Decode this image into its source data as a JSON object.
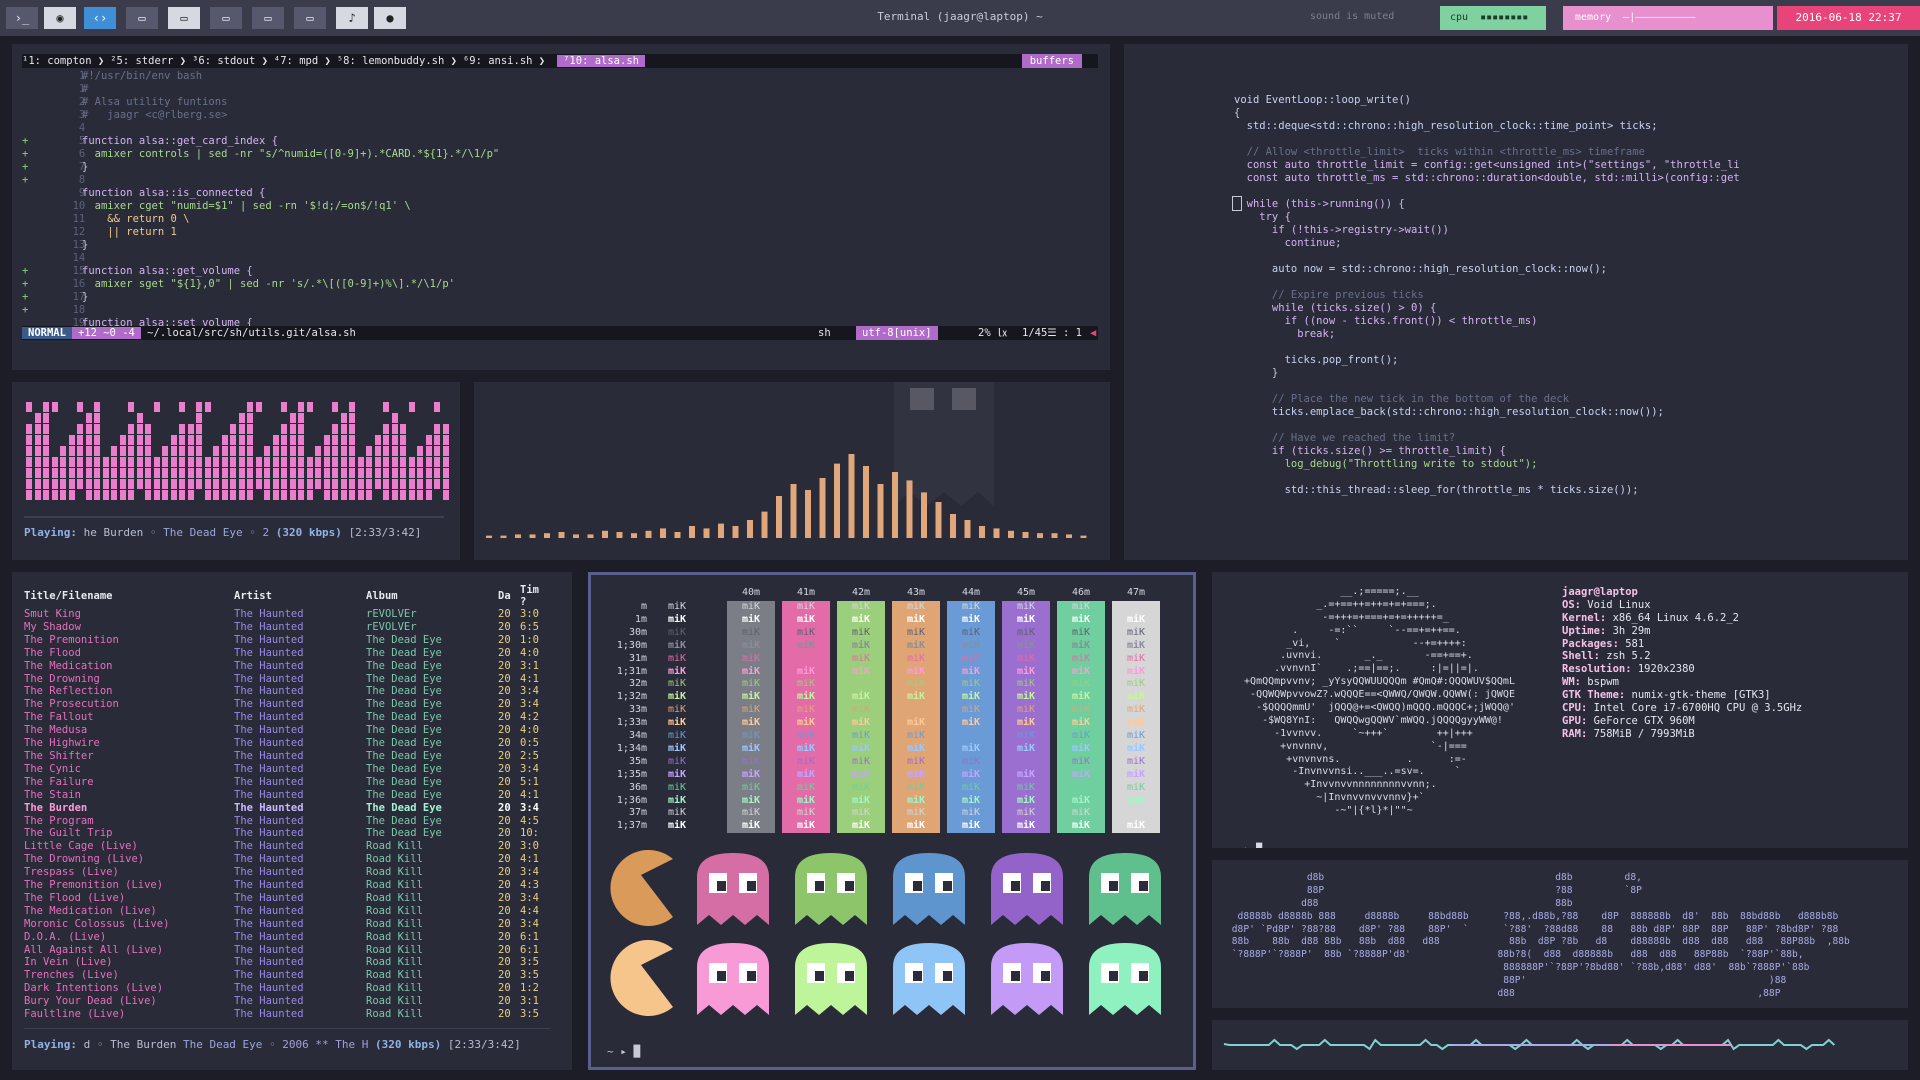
{
  "topbar": {
    "buttons": [
      "›_",
      "◉",
      "‹›",
      "▭",
      "▭",
      "▭",
      "▭",
      "▭",
      "♪",
      "●"
    ],
    "title": "Terminal (jaagr@laptop) ~",
    "sound_status": "sound is muted",
    "cpu_label": "cpu",
    "cpu_meter": "▪▪▪▪▪▪▪▪",
    "memory_label": "memory",
    "memory_meter": "—|——————————",
    "datetime": "2016-06-18 22:37",
    "colors": {
      "cpu": "#7fd2a0",
      "memory": "#e88fce",
      "date": "#e9447a"
    }
  },
  "vim": {
    "tabs": [
      "¹1: compton",
      "²5: stderr",
      "³6: stdout",
      "⁴7: mpd",
      "⁵8: lemonbuddy.sh",
      "⁶9: ansi.sh"
    ],
    "active_tab": "⁷10: alsa.sh",
    "buffers_label": "buffers",
    "lines": [
      {
        "gutter": "  1 ",
        "sign": " ",
        "text": "#!/usr/bin/env bash",
        "cls": "cm"
      },
      {
        "gutter": "  1 ",
        "sign": " ",
        "text": "#",
        "cls": "cm"
      },
      {
        "gutter": "  2 ",
        "sign": " ",
        "text": "# Alsa utility funtions",
        "cls": "cm"
      },
      {
        "gutter": "  3 ",
        "sign": " ",
        "text": "#   jaagr <c@rlberg.se>",
        "cls": "cm"
      },
      {
        "gutter": "  4 ",
        "sign": " ",
        "text": "",
        "cls": ""
      },
      {
        "gutter": "  5 ",
        "sign": "+",
        "text": "function alsa::get_card_index {",
        "cls": "kw"
      },
      {
        "gutter": "  6 ",
        "sign": "+",
        "text": "  amixer controls | sed -nr \"s/^numid=([0-9]+).*CARD.*${1}.*/\\1/p\"",
        "cls": "str"
      },
      {
        "gutter": "  7 ",
        "sign": "+",
        "text": "}",
        "cls": ""
      },
      {
        "gutter": "  8 ",
        "sign": "+",
        "text": "",
        "cls": ""
      },
      {
        "gutter": "  9 ",
        "sign": " ",
        "text": "function alsa::is_connected {",
        "cls": "kw"
      },
      {
        "gutter": " 10 ",
        "sign": " ",
        "text": "  amixer cget \"numid=$1\" | sed -rn '$!d;/=on$/!q1' \\",
        "cls": "str"
      },
      {
        "gutter": " 11 ",
        "sign": " ",
        "text": "    && return 0 \\",
        "cls": "var"
      },
      {
        "gutter": " 12 ",
        "sign": " ",
        "text": "    || return 1",
        "cls": "var"
      },
      {
        "gutter": " 13 ",
        "sign": " ",
        "text": "}",
        "cls": ""
      },
      {
        "gutter": " 14 ",
        "sign": " ",
        "text": "",
        "cls": ""
      },
      {
        "gutter": " 15 ",
        "sign": "+",
        "text": "function alsa::get_volume {",
        "cls": "kw"
      },
      {
        "gutter": " 16 ",
        "sign": "+",
        "text": "  amixer sget \"${1},0\" | sed -nr 's/.*\\[([0-9]+)%\\].*/\\1/p'",
        "cls": "str"
      },
      {
        "gutter": " 17 ",
        "sign": "+",
        "text": "}",
        "cls": ""
      },
      {
        "gutter": " 18 ",
        "sign": "+",
        "text": "",
        "cls": ""
      },
      {
        "gutter": " 19 ",
        "sign": " ",
        "text": "function alsa::set_volume {",
        "cls": "kw"
      }
    ],
    "status": {
      "mode": "NORMAL",
      "hunks": "+12 ~0 -4",
      "path": "~/.local/src/sh/utils.git/alsa.sh",
      "filetype": "sh",
      "encoding": "utf-8[unix]",
      "percent": "2% ㏓",
      "position": "1/45☰ :  1"
    }
  },
  "cpp": {
    "lines": [
      {
        "text": "void EventLoop::loop_write()",
        "cls": "fn"
      },
      {
        "text": "{",
        "cls": ""
      },
      {
        "text": "  std::deque<std::chrono::high_resolution_clock::time_point> ticks;",
        "cls": "fn"
      },
      {
        "text": "",
        "cls": ""
      },
      {
        "text": "  // Allow <throttle_limit>  ticks within <throttle_ms> timeframe",
        "cls": "cm"
      },
      {
        "text": "  const auto throttle_limit = config::get<unsigned int>(\"settings\", \"throttle_li",
        "cls": "kw"
      },
      {
        "text": "  const auto throttle_ms = std::chrono::duration<double, std::milli>(config::get",
        "cls": "kw"
      },
      {
        "text": "",
        "cls": ""
      },
      {
        "text": "  while (this->running()) {",
        "cls": "kw"
      },
      {
        "text": "    try {",
        "cls": "kw"
      },
      {
        "text": "      if (!this->registry->wait())",
        "cls": "kw"
      },
      {
        "text": "        continue;",
        "cls": "kw"
      },
      {
        "text": "",
        "cls": ""
      },
      {
        "text": "      auto now = std::chrono::high_resolution_clock::now();",
        "cls": "fn"
      },
      {
        "text": "",
        "cls": ""
      },
      {
        "text": "      // Expire previous ticks",
        "cls": "cm"
      },
      {
        "text": "      while (ticks.size() > 0) {",
        "cls": "kw"
      },
      {
        "text": "        if ((now - ticks.front()) < throttle_ms)",
        "cls": "kw"
      },
      {
        "text": "          break;",
        "cls": "kw"
      },
      {
        "text": "",
        "cls": ""
      },
      {
        "text": "        ticks.pop_front();",
        "cls": "fn"
      },
      {
        "text": "      }",
        "cls": ""
      },
      {
        "text": "",
        "cls": ""
      },
      {
        "text": "      // Place the new tick in the bottom of the deck",
        "cls": "cm"
      },
      {
        "text": "      ticks.emplace_back(std::chrono::high_resolution_clock::now());",
        "cls": "fn"
      },
      {
        "text": "",
        "cls": ""
      },
      {
        "text": "      // Have we reached the limit?",
        "cls": "cm"
      },
      {
        "text": "      if (ticks.size() >= throttle_limit) {",
        "cls": "kw"
      },
      {
        "text": "        log_debug(\"Throttling write to stdout\");",
        "cls": "str"
      },
      {
        "text": "",
        "cls": ""
      },
      {
        "text": "        std::this_thread::sleep_for(throttle_ms * ticks.size());",
        "cls": "fn"
      }
    ]
  },
  "now_playing_top": {
    "label": "Playing:",
    "title": "he Burden",
    "sep1": "◦",
    "album": "The Dead Eye",
    "sep2": "◦",
    "track": "2",
    "bitrate": "(320 kbps)",
    "time": "[2:33/3:42]"
  },
  "visualizer": {
    "levels": [
      0.02,
      0.02,
      0.03,
      0.03,
      0.04,
      0.05,
      0.03,
      0.03,
      0.06,
      0.05,
      0.04,
      0.06,
      0.08,
      0.05,
      0.1,
      0.08,
      0.12,
      0.1,
      0.15,
      0.22,
      0.35,
      0.45,
      0.4,
      0.5,
      0.62,
      0.7,
      0.6,
      0.45,
      0.55,
      0.48,
      0.38,
      0.3,
      0.2,
      0.15,
      0.1,
      0.08,
      0.06,
      0.05,
      0.04,
      0.04,
      0.03,
      0.02
    ],
    "color": "#e0a77a"
  },
  "songlist": {
    "headers": [
      "Title/Filename",
      "Artist",
      "Album",
      "Da",
      "Tim",
      "?"
    ],
    "rows": [
      [
        "Smut King",
        "The Haunted",
        "rEVOLVEr",
        "20",
        "3:0"
      ],
      [
        "My Shadow",
        "The Haunted",
        "rEVOLVEr",
        "20",
        "6:5"
      ],
      [
        "The Premonition",
        "The Haunted",
        "The Dead Eye",
        "20",
        "1:0"
      ],
      [
        "The Flood",
        "The Haunted",
        "The Dead Eye",
        "20",
        "4:0"
      ],
      [
        "The Medication",
        "The Haunted",
        "The Dead Eye",
        "20",
        "3:1"
      ],
      [
        "The Drowning",
        "The Haunted",
        "The Dead Eye",
        "20",
        "4:1"
      ],
      [
        "The Reflection",
        "The Haunted",
        "The Dead Eye",
        "20",
        "3:4"
      ],
      [
        "The Prosecution",
        "The Haunted",
        "The Dead Eye",
        "20",
        "3:4"
      ],
      [
        "The Fallout",
        "The Haunted",
        "The Dead Eye",
        "20",
        "4:2"
      ],
      [
        "The Medusa",
        "The Haunted",
        "The Dead Eye",
        "20",
        "4:0"
      ],
      [
        "The Highwire",
        "The Haunted",
        "The Dead Eye",
        "20",
        "0:5"
      ],
      [
        "The Shifter",
        "The Haunted",
        "The Dead Eye",
        "20",
        "2:5"
      ],
      [
        "The Cynic",
        "The Haunted",
        "The Dead Eye",
        "20",
        "3:4"
      ],
      [
        "The Failure",
        "The Haunted",
        "The Dead Eye",
        "20",
        "5:1"
      ],
      [
        "The Stain",
        "The Haunted",
        "The Dead Eye",
        "20",
        "4:1"
      ],
      [
        "The Burden",
        "The Haunted",
        "The Dead Eye",
        "20",
        "3:4"
      ],
      [
        "The Program",
        "The Haunted",
        "The Dead Eye",
        "20",
        "4:5"
      ],
      [
        "The Guilt Trip",
        "The Haunted",
        "The Dead Eye",
        "20",
        "10:"
      ],
      [
        "Little Cage (Live)",
        "The Haunted",
        "Road Kill",
        "20",
        "3:0"
      ],
      [
        "The Drowning (Live)",
        "The Haunted",
        "Road Kill",
        "20",
        "4:1"
      ],
      [
        "Trespass (Live)",
        "The Haunted",
        "Road Kill",
        "20",
        "3:4"
      ],
      [
        "The Premonition (Live)",
        "The Haunted",
        "Road Kill",
        "20",
        "4:3"
      ],
      [
        "The Flood (Live)",
        "The Haunted",
        "Road Kill",
        "20",
        "3:4"
      ],
      [
        "The Medication (Live)",
        "The Haunted",
        "Road Kill",
        "20",
        "4:4"
      ],
      [
        "Moronic Colossus (Live)",
        "The Haunted",
        "Road Kill",
        "20",
        "3:4"
      ],
      [
        "D.O.A. (Live)",
        "The Haunted",
        "Road Kill",
        "20",
        "6:1"
      ],
      [
        "All Against All (Live)",
        "The Haunted",
        "Road Kill",
        "20",
        "6:1"
      ],
      [
        "In Vein (Live)",
        "The Haunted",
        "Road Kill",
        "20",
        "3:5"
      ],
      [
        "Trenches (Live)",
        "The Haunted",
        "Road Kill",
        "20",
        "3:5"
      ],
      [
        "Dark Intentions (Live)",
        "The Haunted",
        "Road Kill",
        "20",
        "1:2"
      ],
      [
        "Bury Your Dead (Live)",
        "The Haunted",
        "Road Kill",
        "20",
        "3:1"
      ],
      [
        "Faultline (Live)",
        "The Haunted",
        "Road Kill",
        "20",
        "3:5"
      ]
    ],
    "highlight_index": 15,
    "now_playing": {
      "label": "Playing:",
      "text": "d ◦ The Burden",
      "album": "The Dead Eye",
      "year": "◦ 2006 ** The H",
      "bitrate": "(320 kbps)",
      "time": "[2:33/3:42]"
    }
  },
  "colorscheme": {
    "headers": [
      "40m",
      "41m",
      "42m",
      "43m",
      "44m",
      "45m",
      "46m",
      "47m"
    ],
    "row_labels": [
      "m",
      "1m",
      "30m",
      "1;30m",
      "31m",
      "1;31m",
      "32m",
      "1;32m",
      "33m",
      "1;33m",
      "34m",
      "1;34m",
      "35m",
      "1;35m",
      "36m",
      "1;36m",
      "37m",
      "1;37m"
    ],
    "cell_text": "miK",
    "bg_colors": [
      "#7b7e86",
      "#e36ba8",
      "#9ccf7b",
      "#e0a574",
      "#6a9bd6",
      "#9a6fd0",
      "#6fcf9e",
      "#d6d6d6"
    ],
    "fg_colors": [
      "#d7d7e0",
      "#ffffff",
      "#5e6170",
      "#8a8d9c",
      "#e36ba8",
      "#ff9ad8",
      "#9ccf7b",
      "#c6f39e",
      "#e0a574",
      "#ffc998",
      "#6a9bd6",
      "#9cc7ff",
      "#9a6fd0",
      "#c5a3ff",
      "#6fcf9e",
      "#a2f5c8",
      "#d6d6d6",
      "#ffffff"
    ],
    "prompt": "~ ▸ █"
  },
  "pacman": {
    "row1_colors": [
      "#d99a5a",
      "#d66ea6",
      "#8cc56a",
      "#5e95cf",
      "#9363c9",
      "#5fc08d"
    ],
    "row2_colors": [
      "#f5c58c",
      "#f79ad6",
      "#bff59a",
      "#8fc4f7",
      "#c49af7",
      "#8ff0c0"
    ]
  },
  "neofetch": {
    "art": [
      "                  __.;=====;.__",
      "              _.=+==++=++=+=+===;.",
      "               -=+++=+===+=+=+++++=_",
      "          .     -=:``     `--==+=++==.",
      "         _vi,    `            --+=++++:",
      "        .uvnvi.       _._       -==+==+.",
      "       .vvnvnI`    .;==|==;.     :|=||=|.",
      "  +QmQQmpvvnv; _yYsyQQWUUQQQm #QmQ#:QQQWUV$QQmL",
      "   -QQWQWpvvowZ?.wQQQE==<QWWQ/QWQW.QQWW(: jQWQE",
      "    -$QQQQmmU'  jQQQ@+=<QWQQ)mQQQ.mQQQC+;jWQQ@'",
      "     -$WQ8YnI:   QWQQwgQQWV`mWQQ.jQQQQgyyWW@!",
      "       -1vvnvv.     `~+++`        ++|+++",
      "        +vnvnnv,                 `-|===",
      "         +vnvnvns.           .      :=-",
      "          -Invnvvnsi..___..=sv=.     `",
      "            +Invvnvvnnnnnnnnvvnn;.",
      "              ~|Invnvvnvvvnnv}+`",
      "                 -~\"|{*l}*|\"\"~",
      "",
      "",
      "~ ▸ █"
    ],
    "info": [
      {
        "k": "",
        "v": "jaagr@laptop",
        "user": true
      },
      {
        "k": "OS:",
        "v": "Void Linux"
      },
      {
        "k": "Kernel:",
        "v": "x86_64 Linux 4.6.2_2"
      },
      {
        "k": "Uptime:",
        "v": "3h 29m"
      },
      {
        "k": "Packages:",
        "v": "581"
      },
      {
        "k": "Shell:",
        "v": "zsh 5.2"
      },
      {
        "k": "Resolution:",
        "v": "1920x2380"
      },
      {
        "k": "WM:",
        "v": "bspwm"
      },
      {
        "k": "GTK Theme:",
        "v": "numix-gtk-theme [GTK3]"
      },
      {
        "k": "CPU:",
        "v": "Intel Core i7-6700HQ CPU @ 3.5GHz"
      },
      {
        "k": "GPU:",
        "v": "GeForce GTX 960M"
      },
      {
        "k": "RAM:",
        "v": "758MiB / 7993MiB"
      }
    ]
  },
  "figlet": {
    "art": [
      "              d8b                                        d8b         d8,",
      "              88P                                        ?88         `8P",
      "             d88                                         88b",
      "  d8888b d8888b 888     d8888b     88bd88b      ?88,.d88b,?88    d8P  888888b  d8'  88b  88bd88b   d888b8b",
      " d8P' `Pd8P' ?88?88    d8P' ?88    88P'  `      `?88'  ?88d88    88   88b d8P' 88P  88P   88P' ?8bd8P' ?88",
      " 88b    88b  d88 88b   88b  d88   d88            88b  d8P ?8b   d8    d88888b  d88  d88   d88   88P88b  ,88b",
      " `?888P'`?888P'  88b `?8888P'd8'               88b?8(  d88  d88888b   d88  d88   88P88b  `?88P'`88b,",
      "                                                888888P'`?88P'?8bd88' `?88b,d88' d88'  88b`?888P'`88b",
      "                                                88P'                                          )88",
      "                                               d88                                          ,88P"
    ]
  },
  "wave": {
    "colors": [
      "#7fd2d0",
      "#a9ade7",
      "#e88fce",
      "#6a9bd6"
    ]
  }
}
